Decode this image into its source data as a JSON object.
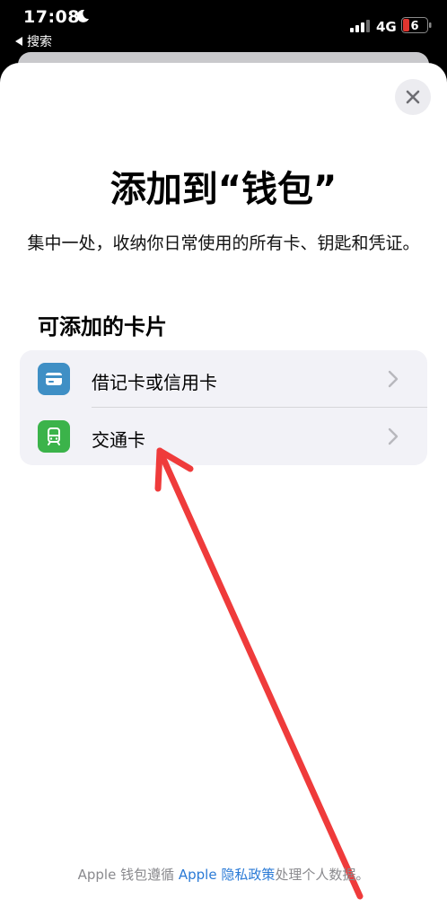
{
  "status_bar": {
    "time": "17:08",
    "back_label": "搜索",
    "network": "4G",
    "battery": "6"
  },
  "sheet": {
    "title": "添加到“钱包”",
    "subtitle": "集中一处，收纳你日常使用的所有卡、钥匙和凭证。",
    "section_title": "可添加的卡片",
    "cards": [
      {
        "label": "借记卡或信用卡",
        "icon": "credit-card-icon",
        "icon_color": "#3f8fc5"
      },
      {
        "label": "交通卡",
        "icon": "train-icon",
        "icon_color": "#3bb34a"
      }
    ]
  },
  "footer": {
    "prefix": "Apple 钱包遵循 ",
    "link": "Apple 隐私政策",
    "suffix": "处理个人数据。"
  },
  "annotation": {
    "arrow_color": "#ef3b3b"
  }
}
